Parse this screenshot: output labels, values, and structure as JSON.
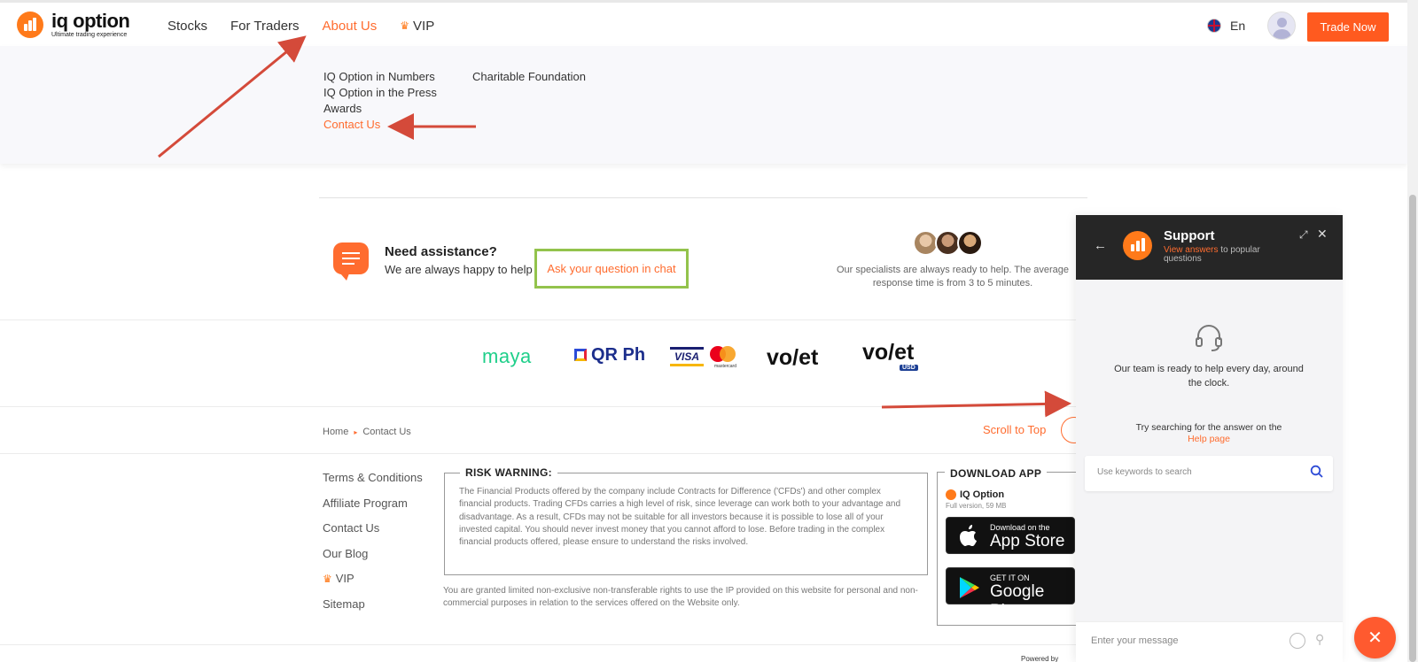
{
  "header": {
    "logo_name": "iq option",
    "logo_tagline": "Ultimate trading experience",
    "nav": [
      {
        "label": "Stocks"
      },
      {
        "label": "For Traders"
      },
      {
        "label": "About Us"
      },
      {
        "label": "VIP"
      }
    ],
    "language": "En",
    "trade_button": "Trade Now"
  },
  "dropdown": {
    "col1": [
      "IQ Option in Numbers",
      "IQ Option in the Press",
      "Awards",
      "Contact Us"
    ],
    "col2": [
      "Charitable Foundation"
    ]
  },
  "assistance": {
    "title": "Need assistance?",
    "subtitle": "We are always happy to help",
    "link": "Ask your question in chat",
    "specialists_text": "Our specialists are always ready to help. The average response time is from 3 to 5 minutes."
  },
  "payments": [
    "maya",
    "QR Ph",
    "VISA",
    "mastercard",
    "vo/et",
    "vo/et",
    "USD"
  ],
  "breadcrumb": {
    "home": "Home",
    "current": "Contact Us"
  },
  "scroll_top": "Scroll to Top",
  "footer_links": [
    "Terms & Conditions",
    "Affiliate Program",
    "Contact Us",
    "Our Blog",
    "VIP",
    "Sitemap"
  ],
  "risk": {
    "title": "RISK WARNING:",
    "text": "The Financial Products offered by the company include Contracts for Difference ('CFDs') and other complex financial products. Trading CFDs carries a high level of risk, since leverage can work both to your advantage and disadvantage. As a result, CFDs may not be suitable for all investors because it is possible to lose all of your invested capital. You should never invest money that you cannot afford to lose. Before trading in the complex financial products offered, please ensure to understand the risks involved.",
    "rights": "You are granted limited non-exclusive non-transferable rights to use the IP provided on this website for personal and non-commercial purposes in relation to the services offered on the Website only."
  },
  "download": {
    "title": "DOWNLOAD APP",
    "app_name": "IQ Option",
    "app_size": "Full version, 59 MB",
    "appstore_small": "Download on the",
    "appstore_big": "App Store",
    "gplay_small": "GET IT ON",
    "gplay_big": "Google Play"
  },
  "chat": {
    "title": "Support",
    "sub_link": "View answers",
    "sub_rest": " to popular questions",
    "body_text": "Our team is ready to help every day, around the clock.",
    "search_hint": "Try searching for the answer on the",
    "help_link": "Help page",
    "search_placeholder": "Use keywords to search",
    "message_placeholder": "Enter your message"
  },
  "powered_by": "Powered by",
  "colors": {
    "accent": "#ff6c2f",
    "highlight_box": "#93c34c",
    "annotation_arrow": "#d44a3a",
    "chat_header": "#262626"
  }
}
